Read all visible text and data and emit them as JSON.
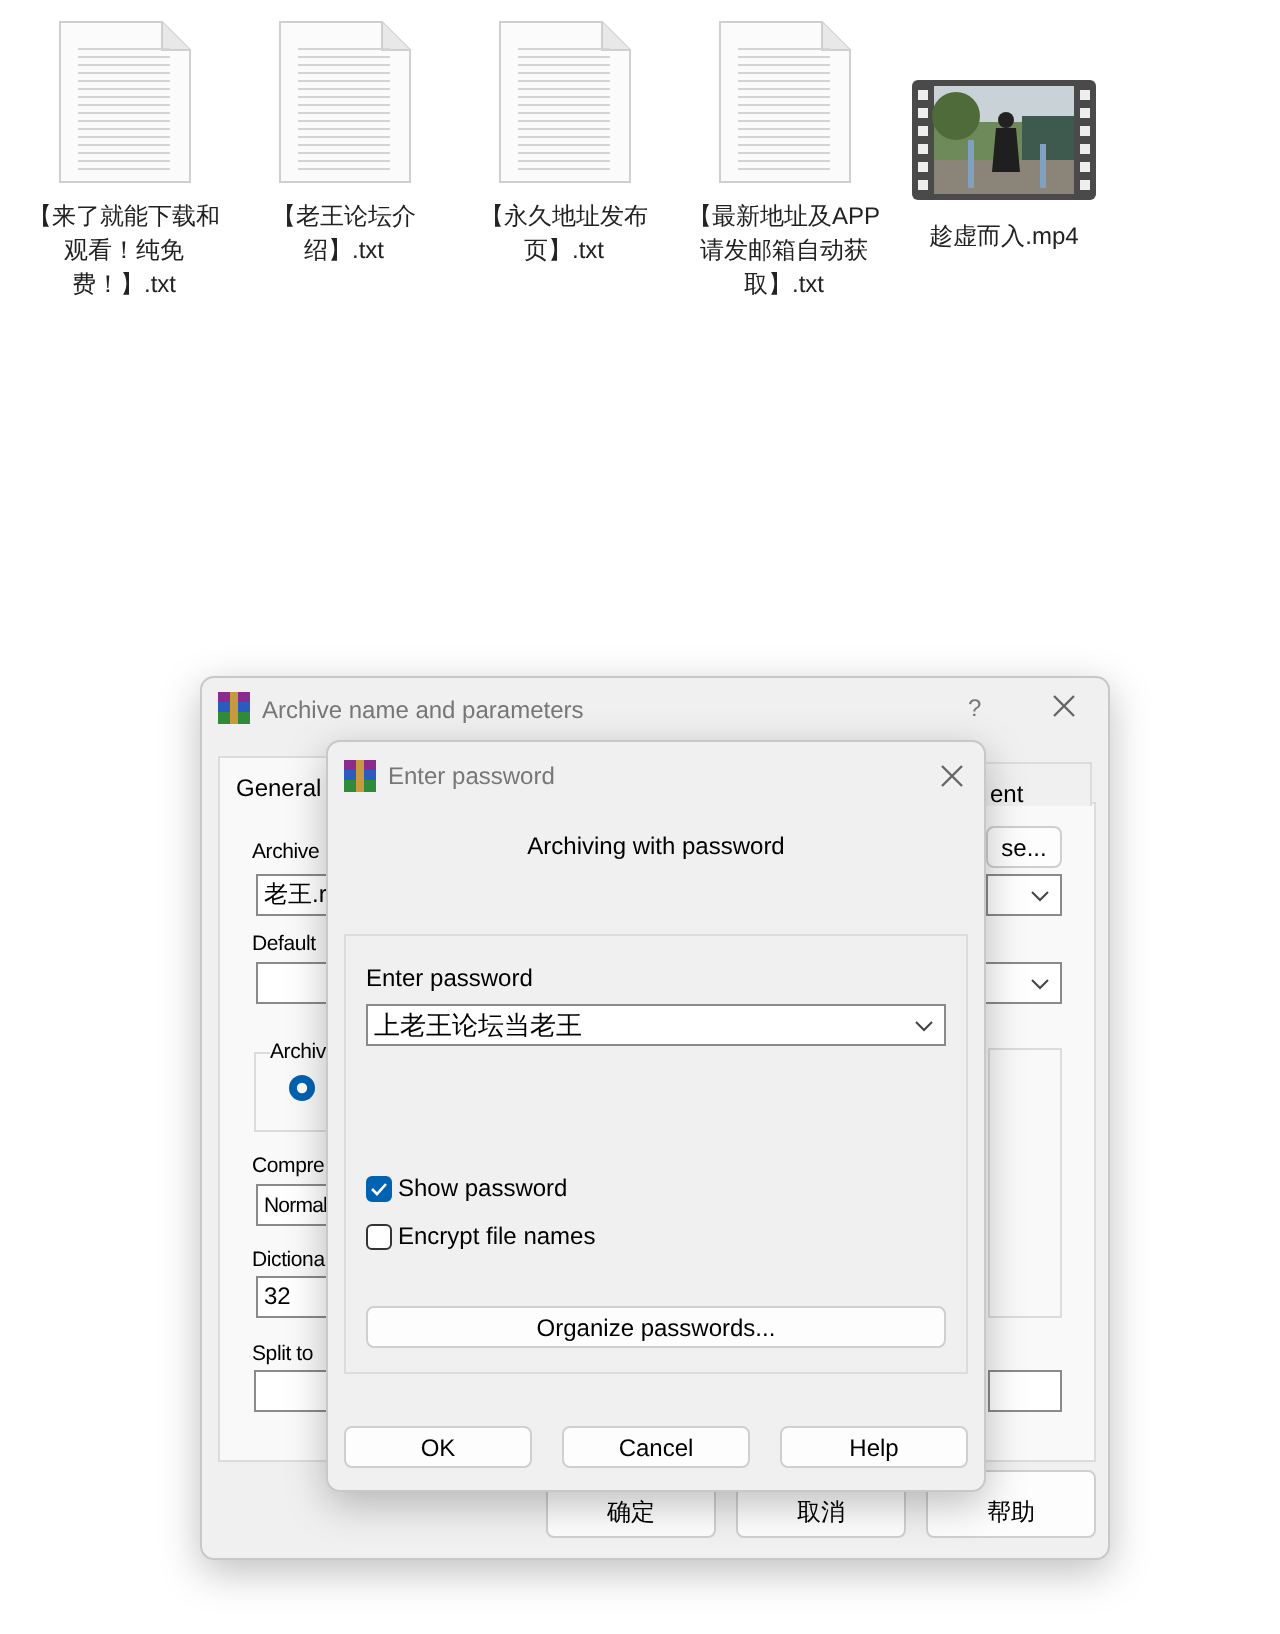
{
  "files": [
    {
      "name": "【来了就能下载和观看！纯免费！】.txt",
      "kind": "text"
    },
    {
      "name": "【老王论坛介绍】.txt",
      "kind": "text"
    },
    {
      "name": "【永久地址发布页】.txt",
      "kind": "text"
    },
    {
      "name": "【最新地址及APP请发邮箱自动获取】.txt",
      "kind": "text"
    },
    {
      "name": "趁虚而入.mp4",
      "kind": "video"
    }
  ],
  "archive_dialog": {
    "title": "Archive name and parameters",
    "help": "?",
    "tabs": [
      {
        "label": "General",
        "selected": true
      },
      {
        "label": "ent",
        "selected": false
      }
    ],
    "archive_label": "Archive",
    "archive_name": "老王.r",
    "browse_button": "se...",
    "default_label": "Default",
    "archive_group_label": "Archiv",
    "format_selected": true,
    "compression_label": "Compre",
    "compression_value": "Normal",
    "dictionary_label": "Dictiona",
    "dictionary_value": "32",
    "split_label": "Split to",
    "buttons": [
      "确定",
      "取消",
      "帮助"
    ]
  },
  "password_dialog": {
    "title": "Enter password",
    "heading": "Archiving with password",
    "password_label": "Enter password",
    "password_value": "上老王论坛当老王",
    "options": [
      {
        "label": "Show password",
        "checked": true
      },
      {
        "label": "Encrypt file names",
        "checked": false
      }
    ],
    "organize_button": "Organize passwords...",
    "buttons": [
      "OK",
      "Cancel",
      "Help"
    ]
  }
}
